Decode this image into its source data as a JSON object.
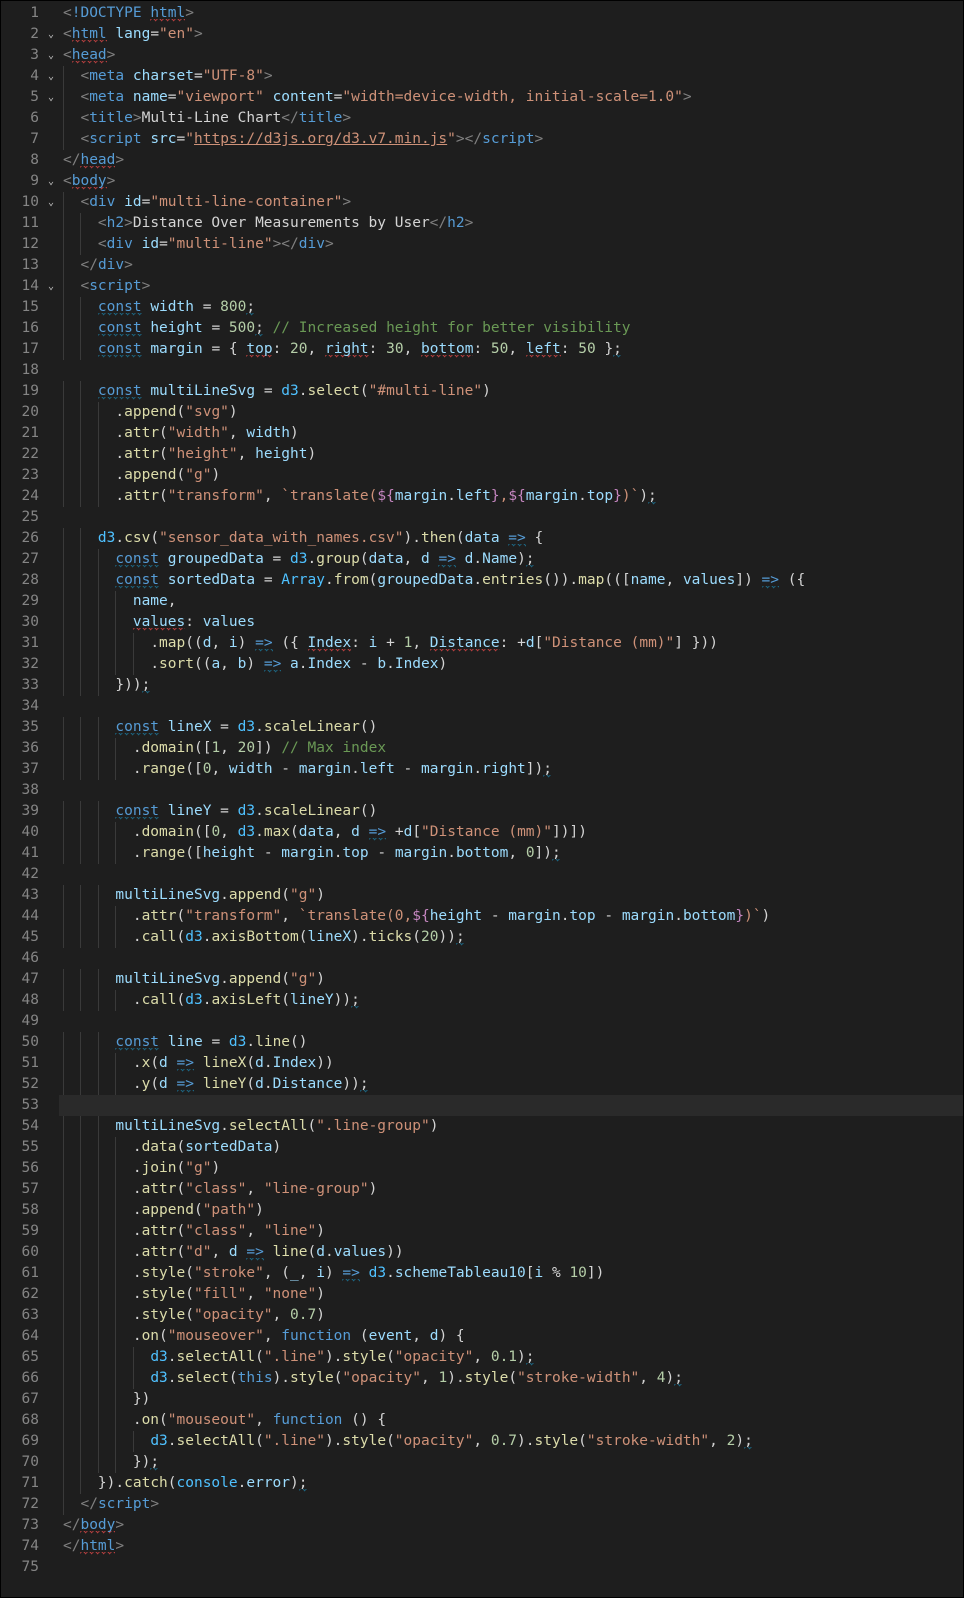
{
  "editor": {
    "language": "html",
    "theme": "vscode-dark",
    "highlighted_line": 53,
    "fold_chevrons": {
      "2": "open",
      "3": "open",
      "4": "open",
      "5": "open",
      "9": "open",
      "10": "open",
      "14": "open"
    },
    "lines": [
      "<!DOCTYPE html>",
      "<html lang=\"en\">",
      "<head>",
      "  <meta charset=\"UTF-8\">",
      "  <meta name=\"viewport\" content=\"width=device-width, initial-scale=1.0\">",
      "  <title>Multi-Line Chart</title>",
      "  <script src=\"https://d3js.org/d3.v7.min.js\"></script>",
      "</head>",
      "<body>",
      "  <div id=\"multi-line-container\">",
      "    <h2>Distance Over Measurements by User</h2>",
      "    <div id=\"multi-line\"></div>",
      "  </div>",
      "  <script>",
      "    const width = 800;",
      "    const height = 500; // Increased height for better visibility",
      "    const margin = { top: 20, right: 30, bottom: 50, left: 50 };",
      "",
      "    const multiLineSvg = d3.select(\"#multi-line\")",
      "      .append(\"svg\")",
      "      .attr(\"width\", width)",
      "      .attr(\"height\", height)",
      "      .append(\"g\")",
      "      .attr(\"transform\", `translate(${margin.left},${margin.top})`);",
      "",
      "    d3.csv(\"sensor_data_with_names.csv\").then(data => {",
      "      const groupedData = d3.group(data, d => d.Name);",
      "      const sortedData = Array.from(groupedData.entries()).map(([name, values]) => ({",
      "        name,",
      "        values: values",
      "          .map((d, i) => ({ Index: i + 1, Distance: +d[\"Distance (mm)\"] }))",
      "          .sort((a, b) => a.Index - b.Index)",
      "      }));",
      "",
      "      const lineX = d3.scaleLinear()",
      "        .domain([1, 20]) // Max index",
      "        .range([0, width - margin.left - margin.right]);",
      "",
      "      const lineY = d3.scaleLinear()",
      "        .domain([0, d3.max(data, d => +d[\"Distance (mm)\"])])",
      "        .range([height - margin.top - margin.bottom, 0]);",
      "",
      "      multiLineSvg.append(\"g\")",
      "        .attr(\"transform\", `translate(0,${height - margin.top - margin.bottom})`)",
      "        .call(d3.axisBottom(lineX).ticks(20));",
      "",
      "      multiLineSvg.append(\"g\")",
      "        .call(d3.axisLeft(lineY));",
      "",
      "      const line = d3.line()",
      "        .x(d => lineX(d.Index))",
      "        .y(d => lineY(d.Distance));",
      "",
      "      multiLineSvg.selectAll(\".line-group\")",
      "        .data(sortedData)",
      "        .join(\"g\")",
      "        .attr(\"class\", \"line-group\")",
      "        .append(\"path\")",
      "        .attr(\"class\", \"line\")",
      "        .attr(\"d\", d => line(d.values))",
      "        .style(\"stroke\", (_, i) => d3.schemeTableau10[i % 10])",
      "        .style(\"fill\", \"none\")",
      "        .style(\"opacity\", 0.7)",
      "        .on(\"mouseover\", function (event, d) {",
      "          d3.selectAll(\".line\").style(\"opacity\", 0.1);",
      "          d3.select(this).style(\"opacity\", 1).style(\"stroke-width\", 4);",
      "        })",
      "        .on(\"mouseout\", function () {",
      "          d3.selectAll(\".line\").style(\"opacity\", 0.7).style(\"stroke-width\", 2);",
      "        });",
      "    }).catch(console.error);",
      "  </script>",
      "</body>",
      "</html>",
      ""
    ]
  }
}
